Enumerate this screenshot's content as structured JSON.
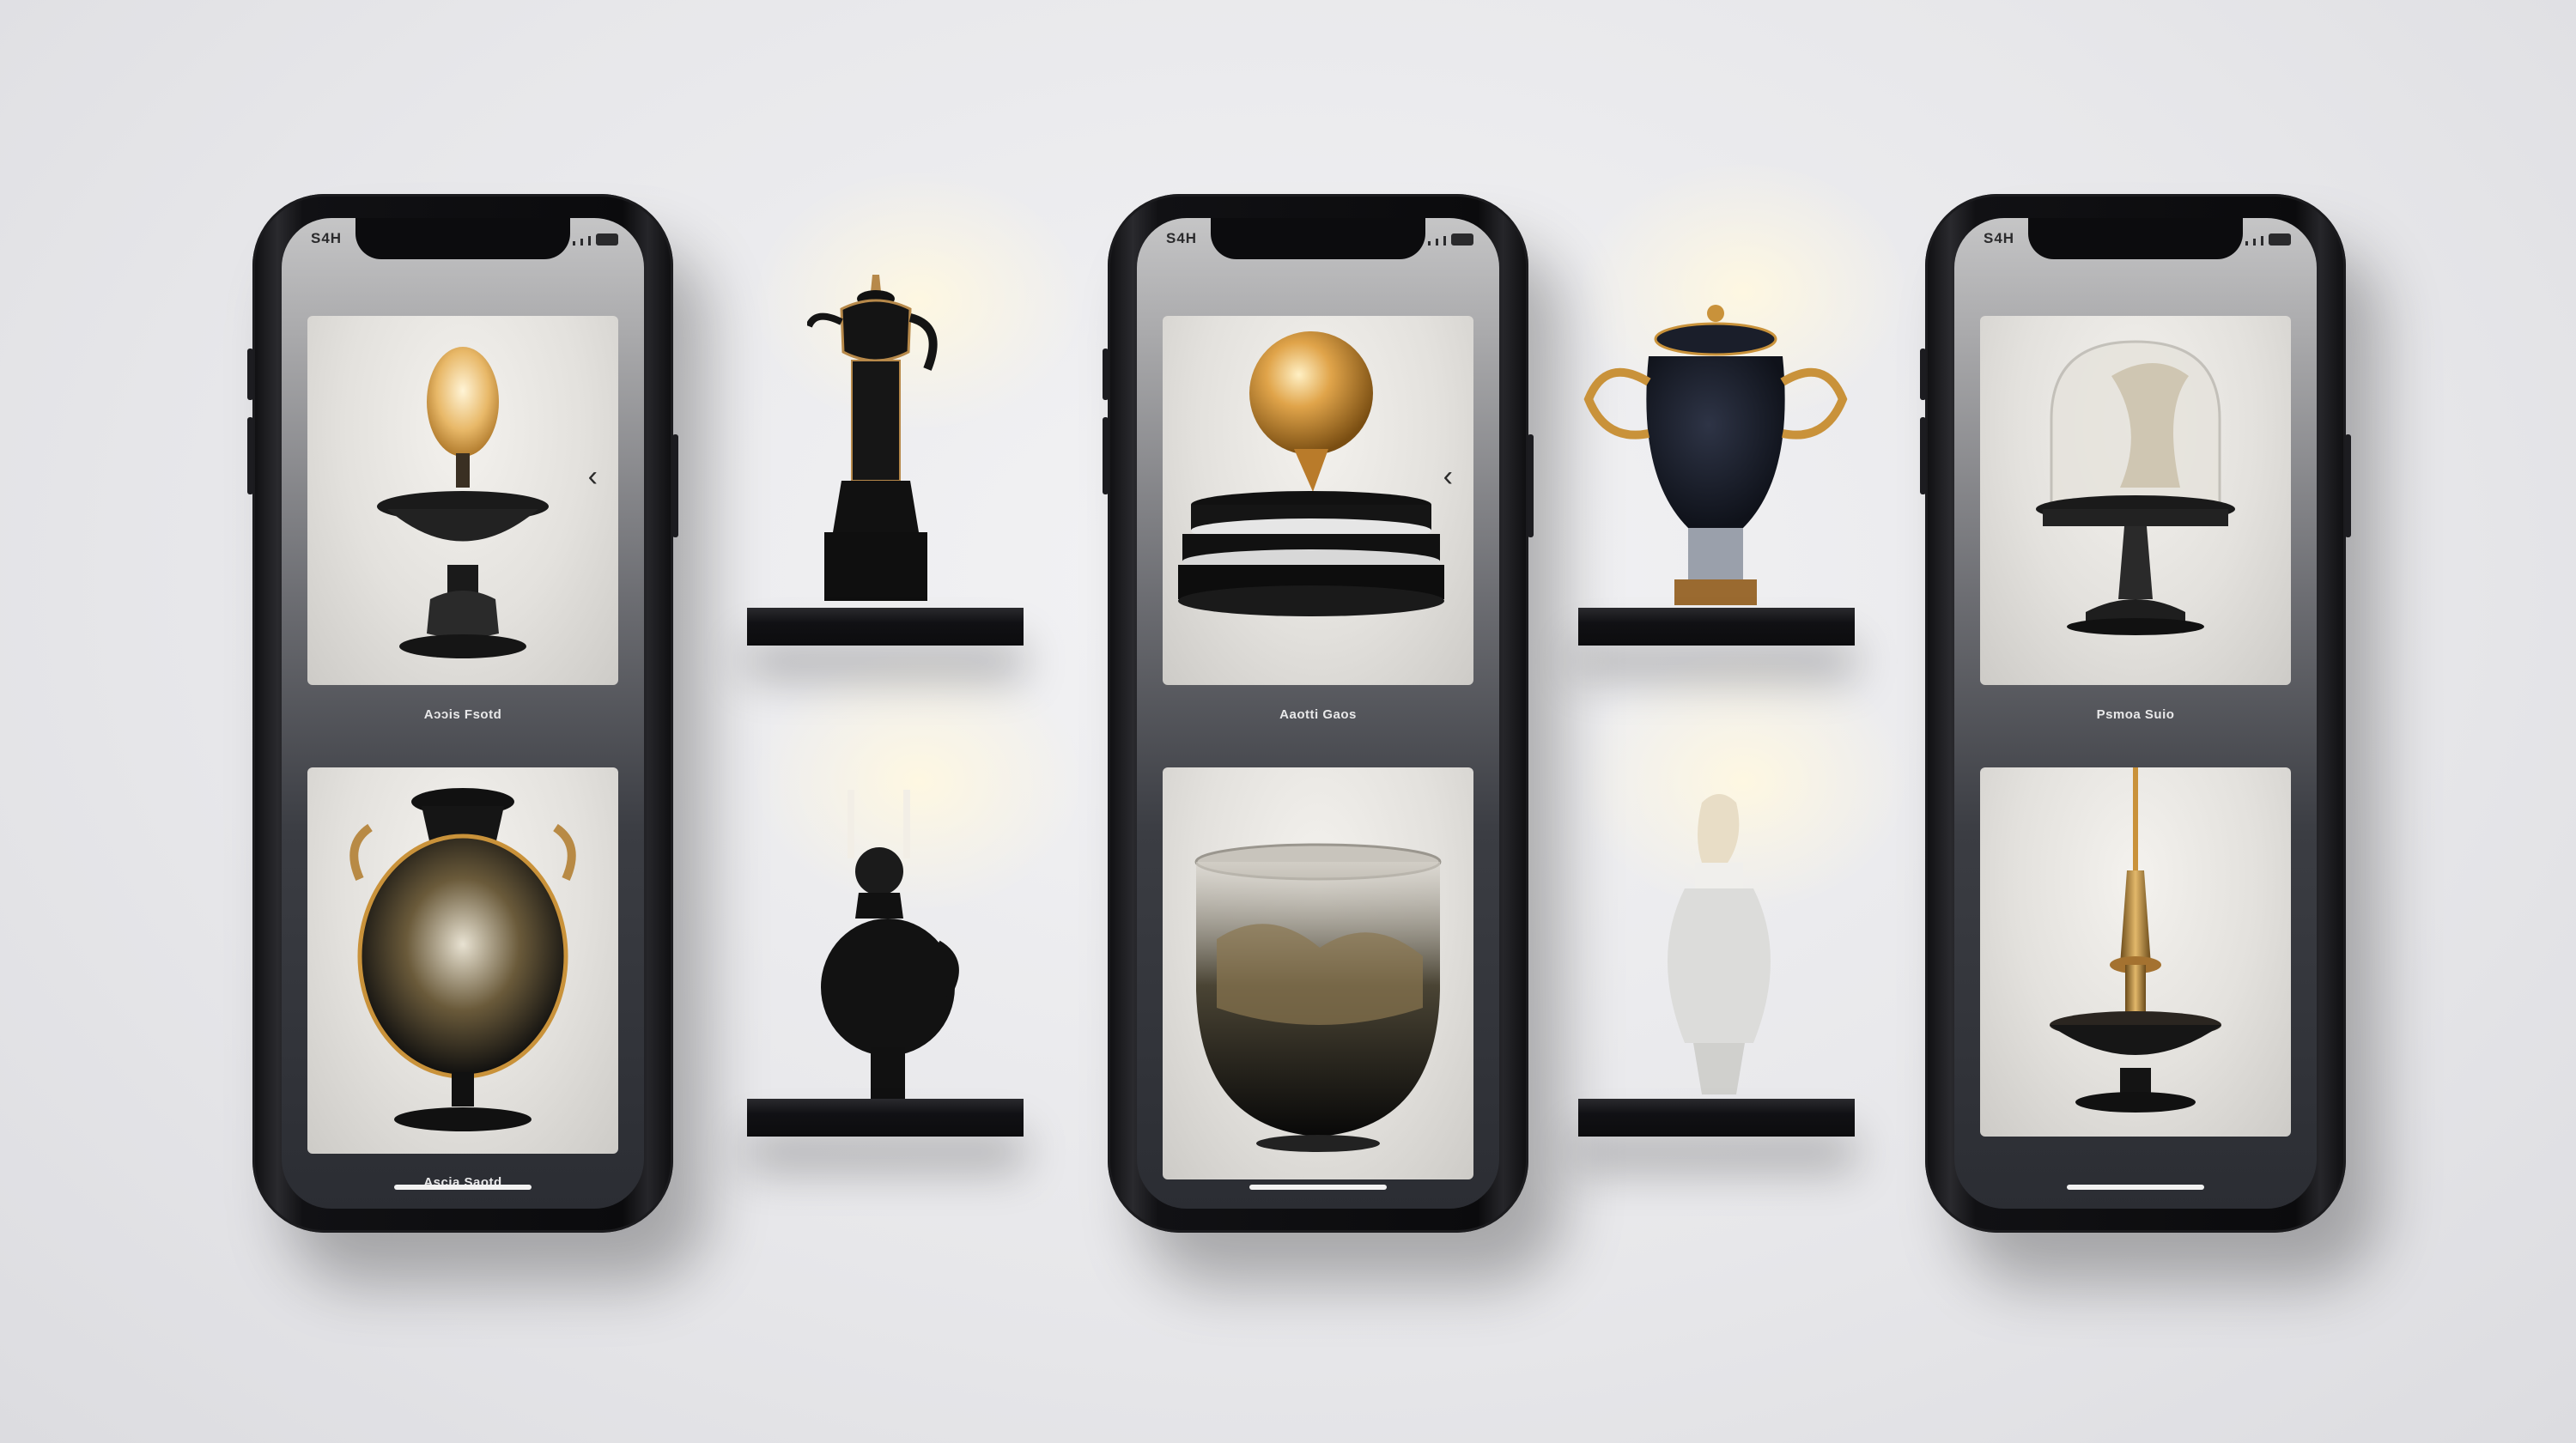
{
  "colors": {
    "background": "#e9e9ec",
    "phone_body": "#111114",
    "screen_top": "#c5c5c6",
    "screen_bottom": "#2b2d33",
    "gold": "#c9923a",
    "shelf": "#111114"
  },
  "phones": [
    {
      "status_time": "S4H",
      "cards": [
        {
          "caption": "Aɔɔis Fsotd",
          "icon": "lamp-urn-icon",
          "has_chevron": true
        },
        {
          "caption": "Ascia Saotd",
          "icon": "black-gold-vase-icon",
          "has_chevron": false
        }
      ]
    },
    {
      "status_time": "S4H",
      "cards": [
        {
          "caption": "Aaotti Gaos",
          "icon": "gold-orb-icon",
          "has_chevron": true
        },
        {
          "caption": "",
          "icon": "glass-bowl-icon",
          "has_chevron": false
        }
      ]
    },
    {
      "status_time": "S4H",
      "cards": [
        {
          "caption": "Psmoa Suio",
          "icon": "glass-dome-icon",
          "has_chevron": false
        },
        {
          "caption": "",
          "icon": "brass-spire-icon",
          "has_chevron": false
        }
      ]
    }
  ],
  "shelves": [
    {
      "item": "teapot-icon"
    },
    {
      "item": "small-vase-candles-icon"
    },
    {
      "item": "trophy-urn-icon"
    },
    {
      "item": "white-vase-figurine-icon"
    }
  ],
  "chevron_glyph": "‹"
}
